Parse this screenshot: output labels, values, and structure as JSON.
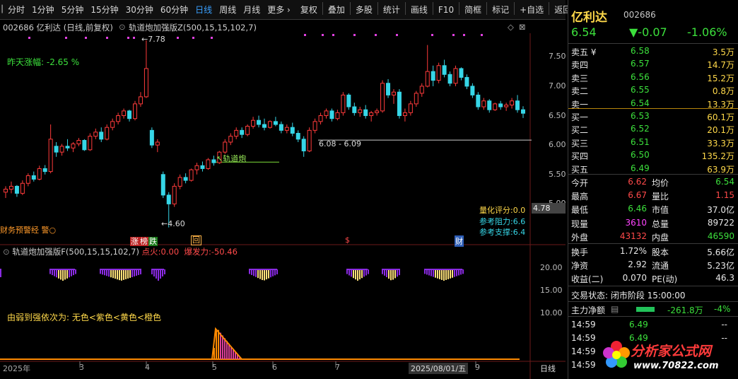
{
  "toolbar": {
    "items": [
      "分时",
      "1分钟",
      "5分钟",
      "15分钟",
      "30分钟",
      "60分钟",
      "日线",
      "周线",
      "月线",
      "更多 ›"
    ],
    "active_index": 6,
    "right_items": [
      "复权",
      "叠加",
      "多股",
      "统计",
      "画线",
      "F10",
      "简框",
      "标记",
      "+自选",
      "返回"
    ]
  },
  "chart_header": {
    "code_name": "002686 亿利达 (日线,前复权)",
    "indicator": "轨道炮加强版Z(500,15,15,102,7)",
    "diamond_icon": "◇",
    "close_icon": "⊠"
  },
  "main_chart": {
    "y_ticks": [
      "7.50",
      "7.00",
      "6.50",
      "6.00",
      "5.50",
      "5.00"
    ],
    "current_price_tag": "4.78",
    "high_label": "7.78",
    "low_label": "4.60",
    "range_label": "6.08 - 6.09",
    "track_label": "轨道炮",
    "yesterday_change_label": "昨天涨幅:",
    "yesterday_change_value": "-2.65 %",
    "quant_score_label": "量化评分:",
    "quant_score_value": "0.0",
    "resistance_label": "参考阻力:",
    "resistance_value": "6.6",
    "support_label": "参考支撑:",
    "support_value": "6.4",
    "risk_label": "财务预警经 警○",
    "markers": {
      "limit_up": "涨",
      "list": "榜",
      "fall": "跌",
      "back": "回",
      "dollar": "$",
      "finance": "财"
    }
  },
  "sub_chart": {
    "title": "轨道炮加强版F(500,15,15,102,7)",
    "fire_label": "点火:",
    "fire_value": "0.00",
    "burst_label": "爆发力:",
    "burst_value": "-50.46",
    "y_ticks": [
      "20.00",
      "15.00",
      "10.00"
    ],
    "legend_text": "由弱到强依次为: 无色<紫色<黄色<橙色"
  },
  "x_axis": {
    "labels": [
      "2025年",
      "3",
      "4",
      "5",
      "6",
      "7",
      "9"
    ],
    "cursor_date": "2025/08/01/五",
    "period": "日线"
  },
  "chart_data": {
    "type": "candlestick",
    "ylim": [
      4.5,
      7.9
    ],
    "candles": [
      [
        5.2,
        5.3,
        5.1,
        5.25
      ],
      [
        5.25,
        5.38,
        5.18,
        5.3
      ],
      [
        5.3,
        5.32,
        5.12,
        5.18
      ],
      [
        5.18,
        5.4,
        5.15,
        5.35
      ],
      [
        5.35,
        5.52,
        5.3,
        5.48
      ],
      [
        5.48,
        5.55,
        5.38,
        5.42
      ],
      [
        5.42,
        5.65,
        5.4,
        5.6
      ],
      [
        5.6,
        5.66,
        5.5,
        5.55
      ],
      [
        5.55,
        6.35,
        5.52,
        6.1
      ],
      [
        5.98,
        6.05,
        5.8,
        5.88
      ],
      [
        5.88,
        6.02,
        5.82,
        5.98
      ],
      [
        5.98,
        6.1,
        5.9,
        5.95
      ],
      [
        5.95,
        6.05,
        5.88,
        6.02
      ],
      [
        6.02,
        6.12,
        5.98,
        6.08
      ],
      [
        6.08,
        6.1,
        5.9,
        5.92
      ],
      [
        5.92,
        6.2,
        5.9,
        6.15
      ],
      [
        6.15,
        6.28,
        6.1,
        6.22
      ],
      [
        6.22,
        6.3,
        6.05,
        6.1
      ],
      [
        6.1,
        6.35,
        6.08,
        6.3
      ],
      [
        6.3,
        6.45,
        6.25,
        6.4
      ],
      [
        6.4,
        6.55,
        6.35,
        6.5
      ],
      [
        6.5,
        6.62,
        6.45,
        6.58
      ],
      [
        6.58,
        6.6,
        6.4,
        6.45
      ],
      [
        6.45,
        6.75,
        6.42,
        6.7
      ],
      [
        6.7,
        6.9,
        6.65,
        6.82
      ],
      [
        6.82,
        7.78,
        6.8,
        7.3
      ],
      [
        6.25,
        6.3,
        5.95,
        6.0
      ],
      [
        6.0,
        6.1,
        5.88,
        6.05
      ],
      [
        5.5,
        5.55,
        5.1,
        5.15
      ],
      [
        5.15,
        5.2,
        4.6,
        5.0
      ],
      [
        5.0,
        5.35,
        4.95,
        5.3
      ],
      [
        5.3,
        5.5,
        5.25,
        5.45
      ],
      [
        5.45,
        5.52,
        5.35,
        5.4
      ],
      [
        5.4,
        5.6,
        5.38,
        5.58
      ],
      [
        5.58,
        5.7,
        5.5,
        5.65
      ],
      [
        5.65,
        5.72,
        5.55,
        5.6
      ],
      [
        5.6,
        5.78,
        5.58,
        5.75
      ],
      [
        5.75,
        5.82,
        5.65,
        5.7
      ],
      [
        5.7,
        5.9,
        5.68,
        5.88
      ],
      [
        5.88,
        6.1,
        5.85,
        6.05
      ],
      [
        6.05,
        6.2,
        6.0,
        6.15
      ],
      [
        6.15,
        6.3,
        6.1,
        6.25
      ],
      [
        6.25,
        6.3,
        6.12,
        6.18
      ],
      [
        6.18,
        6.35,
        6.15,
        6.32
      ],
      [
        6.32,
        6.48,
        6.28,
        6.42
      ],
      [
        6.42,
        6.5,
        6.3,
        6.35
      ],
      [
        6.35,
        6.45,
        6.25,
        6.3
      ],
      [
        6.3,
        6.42,
        6.28,
        6.4
      ],
      [
        6.4,
        6.48,
        6.32,
        6.35
      ],
      [
        6.35,
        6.4,
        6.2,
        6.25
      ],
      [
        6.25,
        6.35,
        6.2,
        6.3
      ],
      [
        6.3,
        6.38,
        6.15,
        6.2
      ],
      [
        6.2,
        6.25,
        6.05,
        6.1
      ],
      [
        6.1,
        6.15,
        5.8,
        5.9
      ],
      [
        5.9,
        6.3,
        5.88,
        6.25
      ],
      [
        6.25,
        6.45,
        6.2,
        6.4
      ],
      [
        6.4,
        6.55,
        6.35,
        6.5
      ],
      [
        6.5,
        6.62,
        6.45,
        6.58
      ],
      [
        6.58,
        6.62,
        6.4,
        6.45
      ],
      [
        6.45,
        6.6,
        6.42,
        6.55
      ],
      [
        6.55,
        6.9,
        6.5,
        6.85
      ],
      [
        6.85,
        6.88,
        6.6,
        6.65
      ],
      [
        6.65,
        6.72,
        6.5,
        6.55
      ],
      [
        6.55,
        6.65,
        6.48,
        6.6
      ],
      [
        6.6,
        6.68,
        6.45,
        6.5
      ],
      [
        6.5,
        6.58,
        6.4,
        6.55
      ],
      [
        6.55,
        6.62,
        6.5,
        6.58
      ],
      [
        6.58,
        7.1,
        6.55,
        7.05
      ],
      [
        7.05,
        7.12,
        6.8,
        6.85
      ],
      [
        6.85,
        6.95,
        6.7,
        6.9
      ],
      [
        6.9,
        6.95,
        6.45,
        6.5
      ],
      [
        6.5,
        6.62,
        6.4,
        6.55
      ],
      [
        6.55,
        6.75,
        6.5,
        6.7
      ],
      [
        6.7,
        6.92,
        6.65,
        6.88
      ],
      [
        6.88,
        7.05,
        6.82,
        7.0
      ],
      [
        7.0,
        7.7,
        6.98,
        7.25
      ],
      [
        7.25,
        7.35,
        7.0,
        7.1
      ],
      [
        7.1,
        7.4,
        7.05,
        7.35
      ],
      [
        7.35,
        7.45,
        7.15,
        7.2
      ],
      [
        7.2,
        7.25,
        7.0,
        7.05
      ],
      [
        7.05,
        7.35,
        7.0,
        7.3
      ],
      [
        7.3,
        7.32,
        7.1,
        7.15
      ],
      [
        7.15,
        7.2,
        6.95,
        7.0
      ],
      [
        7.0,
        7.05,
        6.8,
        6.85
      ],
      [
        6.85,
        6.9,
        6.6,
        6.65
      ],
      [
        6.65,
        6.8,
        6.6,
        6.75
      ],
      [
        6.75,
        6.78,
        6.55,
        6.6
      ],
      [
        6.6,
        6.72,
        6.58,
        6.7
      ],
      [
        6.7,
        6.75,
        6.6,
        6.65
      ],
      [
        6.65,
        6.72,
        6.58,
        6.68
      ],
      [
        6.68,
        6.8,
        6.62,
        6.75
      ],
      [
        6.75,
        6.85,
        6.55,
        6.6
      ],
      [
        6.6,
        6.66,
        6.46,
        6.54
      ]
    ]
  },
  "quote": {
    "name": "亿利达",
    "code": "002686",
    "price": "6.54",
    "change": "▼-0.07",
    "change_pct": "-1.06%",
    "asks": [
      {
        "label": "卖五 ¥",
        "price": "6.58",
        "vol": "3.5万"
      },
      {
        "label": "卖四",
        "price": "6.57",
        "vol": "14.7万"
      },
      {
        "label": "卖三",
        "price": "6.56",
        "vol": "15.2万"
      },
      {
        "label": "卖二",
        "price": "6.55",
        "vol": "0.8万"
      },
      {
        "label": "卖一",
        "price": "6.54",
        "vol": "13.3万"
      }
    ],
    "bids": [
      {
        "label": "买一",
        "price": "6.53",
        "vol": "60.1万"
      },
      {
        "label": "买二",
        "price": "6.52",
        "vol": "20.1万"
      },
      {
        "label": "买三",
        "price": "6.51",
        "vol": "33.3万"
      },
      {
        "label": "买四",
        "price": "6.50",
        "vol": "135.2万"
      },
      {
        "label": "买五",
        "price": "6.49",
        "vol": "63.9万"
      }
    ],
    "stats": [
      {
        "l1": "今开",
        "v1": "6.62",
        "c1": "red",
        "l2": "均价",
        "v2": "6.54",
        "c2": "green"
      },
      {
        "l1": "最高",
        "v1": "6.67",
        "c1": "red",
        "l2": "量比",
        "v2": "1.15",
        "c2": "red"
      },
      {
        "l1": "最低",
        "v1": "6.46",
        "c1": "green",
        "l2": "市值",
        "v2": "37.0亿",
        "c2": "white"
      },
      {
        "l1": "现量",
        "v1": "3610",
        "c1": "magenta",
        "l2": "总量",
        "v2": "89722",
        "c2": "white"
      },
      {
        "l1": "外盘",
        "v1": "43132",
        "c1": "red",
        "l2": "内盘",
        "v2": "46590",
        "c2": "green"
      }
    ],
    "stats2": [
      {
        "l1": "换手",
        "v1": "1.72%",
        "l2": "股本",
        "v2": "5.66亿"
      },
      {
        "l1": "净资",
        "v1": "2.92",
        "l2": "流通",
        "v2": "5.23亿"
      },
      {
        "l1": "收益(二)",
        "v1": "0.070",
        "l2": "PE(动)",
        "v2": "46.3"
      }
    ],
    "trade_status": "交易状态: 闭市阶段 15:00:00",
    "main_flow_label": "主力净额",
    "main_flow_value": "-261.8万",
    "main_flow_pct": "-4%",
    "ticks": [
      {
        "time": "14:59",
        "price": "6.49",
        "vol": "--"
      },
      {
        "time": "14:59",
        "price": "6.49",
        "vol": "--"
      },
      {
        "time": "14:59",
        "price": "",
        "vol": ""
      },
      {
        "time": "14:59",
        "price": "",
        "vol": ""
      }
    ]
  },
  "watermark": {
    "title": "分析家公式网",
    "url": "www.70822.com"
  },
  "colors": {
    "up": "#ff3b3b",
    "down": "#36d6e7",
    "accent": "#3aa0ff"
  }
}
